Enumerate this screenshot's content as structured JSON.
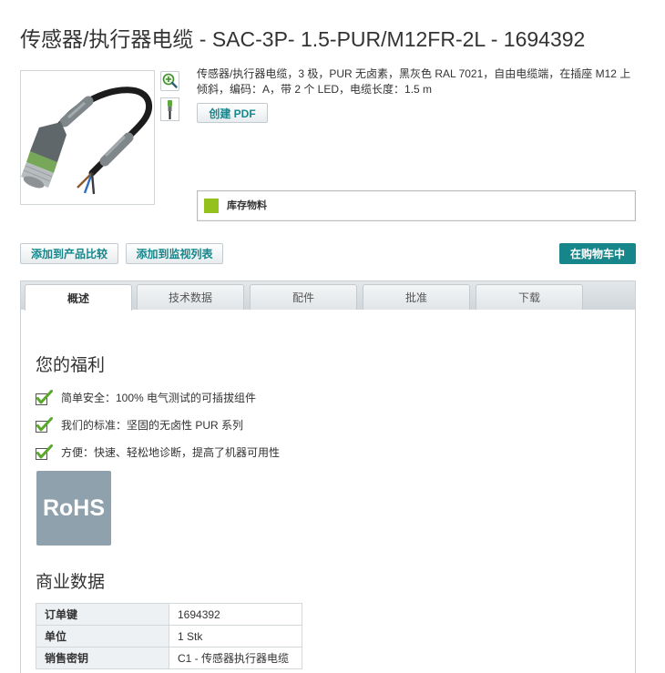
{
  "page": {
    "title": "传感器/执行器电缆 - SAC-3P- 1.5-PUR/M12FR-2L - 1694392"
  },
  "product": {
    "image_icon": "cable-connector-image",
    "zoom_icon": "zoom-in-icon",
    "thumbnail_icon": "connector-thumbnail",
    "description": "传感器/执行器电缆，3 极，PUR 无卤素，黑灰色 RAL 7021，自由电缆端，在插座 M12 上倾斜，编码：A，带 2 个 LED，电缆长度：1.5 m",
    "pdf_button": "创建 PDF"
  },
  "availability": {
    "label": "库存物料",
    "indicator_color": "#94c11c"
  },
  "actions": {
    "compare_button": "添加到产品比较",
    "watchlist_button": "添加到监视列表",
    "cart_button": "在购物车中"
  },
  "tabs": [
    {
      "label": "概述",
      "active": true
    },
    {
      "label": "技术数据",
      "active": false
    },
    {
      "label": "配件",
      "active": false
    },
    {
      "label": "批准",
      "active": false
    },
    {
      "label": "下载",
      "active": false
    }
  ],
  "overview": {
    "benefits_heading": "您的福利",
    "benefit_icon": "checkbox-check-icon",
    "benefits": [
      "简单安全：100% 电气测试的可插拔组件",
      "我们的标准：坚固的无卤性 PUR 系列",
      "方便：快速、轻松地诊断，提高了机器可用性"
    ],
    "rohs_badge": "RoHS",
    "commercial_heading": "商业数据",
    "commercial_data": [
      {
        "key": "订单键",
        "value": "1694392"
      },
      {
        "key": "单位",
        "value": "1 Stk"
      },
      {
        "key": "销售密钥",
        "value": "C1 - 传感器执行器电缆"
      }
    ]
  },
  "theme": {
    "accent": "#16868b",
    "check_green": "#5aa82a",
    "rohs_background": "#8ea1ad",
    "label_cell_background": "#eef1f3"
  }
}
